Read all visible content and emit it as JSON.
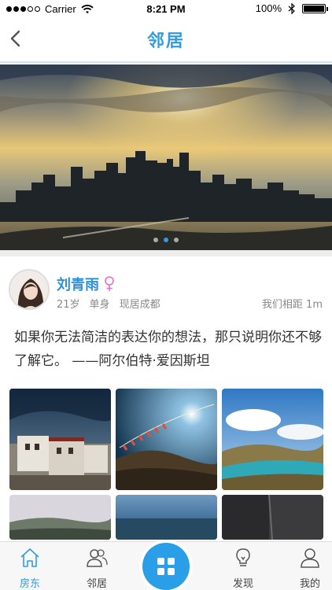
{
  "status_bar": {
    "carrier": "Carrier",
    "time": "8:21 PM",
    "battery": "100%",
    "battery_level": 1.0
  },
  "navbar": {
    "title": "邻居",
    "back_icon": "chevron-left-icon"
  },
  "banner": {
    "image": "city-skyline-sunrise",
    "page_count": 3,
    "active_page": 2
  },
  "profile": {
    "name": "刘青雨",
    "gender_icon": "female-icon",
    "age": "21岁",
    "status": "单身",
    "location": "现居成都",
    "distance": "我们相距 1m"
  },
  "post": {
    "text": "如果你无法简洁的表达你的想法，那只说明你还不够了解它。        ——阿尔伯特·爱因斯坦"
  },
  "photos": [
    {
      "subject": "tibetan-monastery"
    },
    {
      "subject": "prayer-flags-sunburst"
    },
    {
      "subject": "lake-mountains"
    },
    {
      "subject": "misty-landscape"
    },
    {
      "subject": "sea-horizon"
    },
    {
      "subject": "dark-wall"
    }
  ],
  "tabbar": {
    "tabs": [
      {
        "label": "房东",
        "icon": "house-icon",
        "active": true
      },
      {
        "label": "邻居",
        "icon": "people-icon",
        "active": false
      },
      {
        "label": "发现",
        "icon": "lightbulb-icon",
        "active": false
      },
      {
        "label": "我的",
        "icon": "person-icon",
        "active": false
      }
    ],
    "center_icon": "grid-icon"
  },
  "colors": {
    "accent": "#2f9be3",
    "text": "#333333",
    "muted": "#888888",
    "female": "#e86ec7"
  }
}
